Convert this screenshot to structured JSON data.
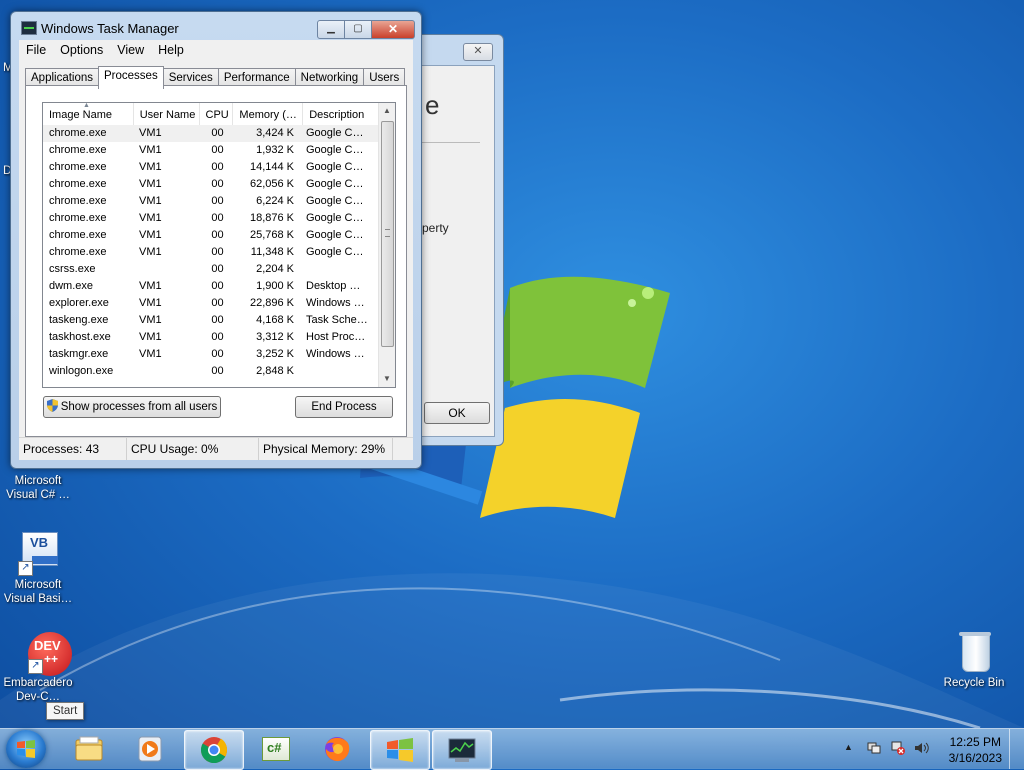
{
  "window": {
    "title": "Windows Task Manager",
    "min_glyph": "▁",
    "max_glyph": "▢",
    "close_glyph": "✕"
  },
  "menu": [
    "File",
    "Options",
    "View",
    "Help"
  ],
  "tabs": [
    "Applications",
    "Processes",
    "Services",
    "Performance",
    "Networking",
    "Users"
  ],
  "active_tab": "Processes",
  "columns": [
    "Image Name",
    "User Name",
    "CPU",
    "Memory (…",
    "Description"
  ],
  "processes": [
    {
      "name": "chrome.exe",
      "user": "VM1",
      "cpu": "00",
      "mem": "3,424 K",
      "desc": "Google C…"
    },
    {
      "name": "chrome.exe",
      "user": "VM1",
      "cpu": "00",
      "mem": "1,932 K",
      "desc": "Google C…"
    },
    {
      "name": "chrome.exe",
      "user": "VM1",
      "cpu": "00",
      "mem": "14,144 K",
      "desc": "Google C…"
    },
    {
      "name": "chrome.exe",
      "user": "VM1",
      "cpu": "00",
      "mem": "62,056 K",
      "desc": "Google C…"
    },
    {
      "name": "chrome.exe",
      "user": "VM1",
      "cpu": "00",
      "mem": "6,224 K",
      "desc": "Google C…"
    },
    {
      "name": "chrome.exe",
      "user": "VM1",
      "cpu": "00",
      "mem": "18,876 K",
      "desc": "Google C…"
    },
    {
      "name": "chrome.exe",
      "user": "VM1",
      "cpu": "00",
      "mem": "25,768 K",
      "desc": "Google C…"
    },
    {
      "name": "chrome.exe",
      "user": "VM1",
      "cpu": "00",
      "mem": "11,348 K",
      "desc": "Google C…"
    },
    {
      "name": "csrss.exe",
      "user": "",
      "cpu": "00",
      "mem": "2,204 K",
      "desc": ""
    },
    {
      "name": "dwm.exe",
      "user": "VM1",
      "cpu": "00",
      "mem": "1,900 K",
      "desc": "Desktop …"
    },
    {
      "name": "explorer.exe",
      "user": "VM1",
      "cpu": "00",
      "mem": "22,896 K",
      "desc": "Windows …"
    },
    {
      "name": "taskeng.exe",
      "user": "VM1",
      "cpu": "00",
      "mem": "4,168 K",
      "desc": "Task Sche…"
    },
    {
      "name": "taskhost.exe",
      "user": "VM1",
      "cpu": "00",
      "mem": "3,312 K",
      "desc": "Host Proc…"
    },
    {
      "name": "taskmgr.exe",
      "user": "VM1",
      "cpu": "00",
      "mem": "3,252 K",
      "desc": "Windows …"
    },
    {
      "name": "winlogon.exe",
      "user": "",
      "cpu": "00",
      "mem": "2,848 K",
      "desc": ""
    }
  ],
  "buttons": {
    "show_all": "Show processes from all users",
    "end_process": "End Process"
  },
  "status": {
    "processes": "Processes: 43",
    "cpu": "CPU Usage: 0%",
    "memory": "Physical Memory: 29%"
  },
  "background_dialog": {
    "big_text": "e",
    "partial_text": "perty",
    "ok_label": "OK",
    "close_glyph": "✕"
  },
  "desktop": {
    "partial_labels": [
      "M",
      "D"
    ],
    "icons": [
      {
        "label": "Microsoft Visual C# …",
        "icon": "visual-csharp-icon"
      },
      {
        "label": "Microsoft Visual Basi…",
        "icon": "visual-basic-icon"
      },
      {
        "label": "Embarcadero Dev-C…",
        "icon": "dev-cpp-icon"
      },
      {
        "label": "Recycle Bin",
        "icon": "recycle-bin-icon"
      }
    ],
    "vb_glyph": "VB",
    "dev_glyph": "DEV",
    "dev_glyph2": "++",
    "shortcut_glyph": "↗"
  },
  "tooltip": "Start",
  "taskbar": {
    "pinned": [
      "explorer-icon",
      "media-player-icon",
      "chrome-icon",
      "visual-csharp-icon",
      "firefox-icon",
      "windows-flag-icon",
      "task-manager-icon"
    ],
    "csharp_glyph": "c#",
    "tray_arrow": "▲",
    "clock_time": "12:25 PM",
    "clock_date": "3/16/2023"
  },
  "colors": {
    "desktop_bg": "#1c6cc4",
    "close_button": "#c9402b",
    "selection": "#f0f0f0"
  }
}
